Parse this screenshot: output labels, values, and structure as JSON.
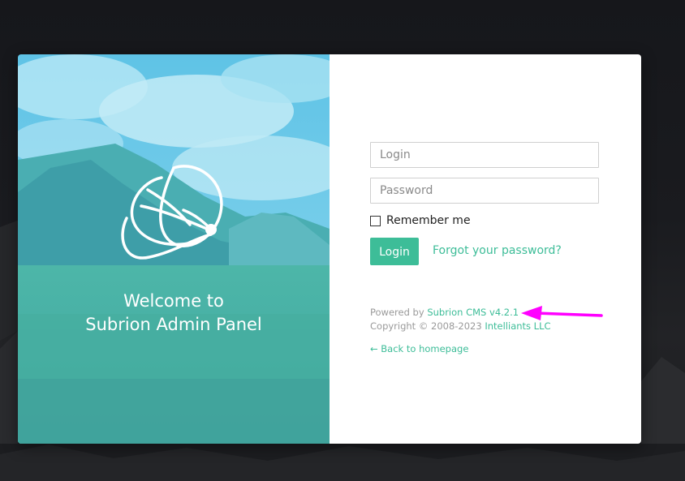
{
  "welcome": {
    "line1": "Welcome to",
    "line2": "Subrion Admin Panel"
  },
  "form": {
    "login_placeholder": "Login",
    "password_placeholder": "Password",
    "remember_label": "Remember me",
    "login_button": "Login",
    "forgot_link": "Forgot your password?"
  },
  "footer": {
    "powered_prefix": "Powered by ",
    "powered_link": "Subrion CMS v4.2.1",
    "copyright_prefix": "Copyright © 2008-2023 ",
    "copyright_link": "Intelliants LLC",
    "back_link": "← Back to homepage"
  },
  "icons": {
    "logo": "subrion-logo-icon",
    "annotation": "magenta-arrow-icon"
  },
  "colors": {
    "accent": "#3dbd98",
    "overlay": "#4fb8d6",
    "annotation": "#ff00ff"
  }
}
